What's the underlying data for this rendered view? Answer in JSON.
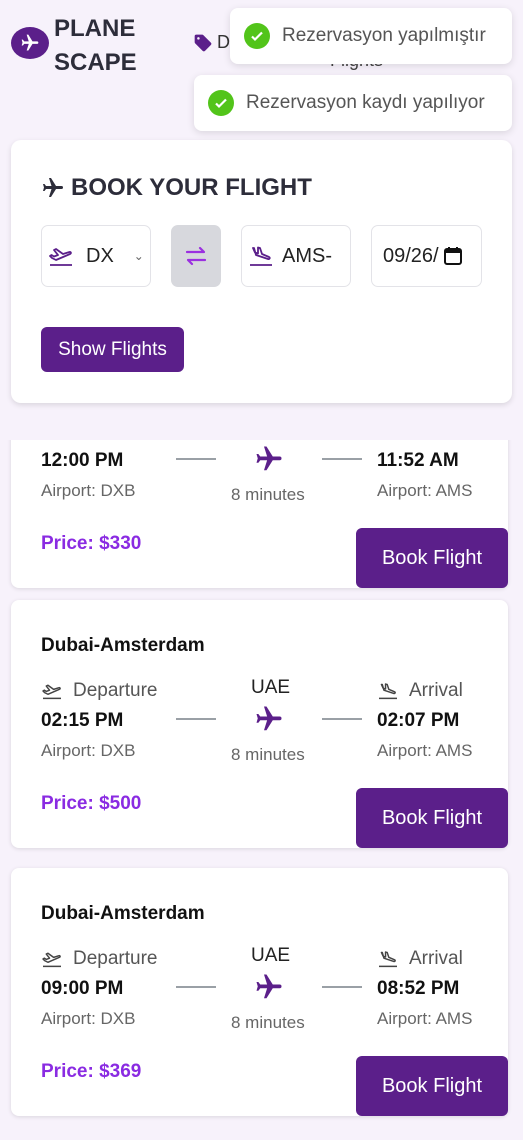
{
  "header": {
    "logo_line1": "PLANE",
    "logo_line2": "SCAPE",
    "deals_label": "D",
    "flights_label": "Flights"
  },
  "toasts": [
    {
      "text": "Rezervasyon yapılmıştır",
      "icon": "check-circle-icon"
    },
    {
      "text": "Rezervasyon kaydı yapılıyor",
      "icon": "check-circle-icon"
    }
  ],
  "booking": {
    "title": "BOOK YOUR FLIGHT",
    "from_value": "DX",
    "to_value": "AMS-",
    "date_value": "09/26/",
    "show_button": "Show Flights"
  },
  "flights": [
    {
      "route": "",
      "departure_label": "",
      "arrival_label": "",
      "airline": "",
      "dep_time": "12:00 PM",
      "arr_time": "11:52 AM",
      "dep_airport": "Airport: DXB",
      "arr_airport": "Airport: AMS",
      "duration": "8 minutes",
      "price": "Price: $330",
      "book_label": "Book Flight"
    },
    {
      "route": "Dubai-Amsterdam",
      "departure_label": "Departure",
      "arrival_label": "Arrival",
      "airline": "UAE",
      "dep_time": "02:15 PM",
      "arr_time": "02:07 PM",
      "dep_airport": "Airport: DXB",
      "arr_airport": "Airport: AMS",
      "duration": "8 minutes",
      "price": "Price: $500",
      "book_label": "Book Flight"
    },
    {
      "route": "Dubai-Amsterdam",
      "departure_label": "Departure",
      "arrival_label": "Arrival",
      "airline": "UAE",
      "dep_time": "09:00 PM",
      "arr_time": "08:52 PM",
      "dep_airport": "Airport: DXB",
      "arr_airport": "Airport: AMS",
      "duration": "8 minutes",
      "price": "Price: $369",
      "book_label": "Book Flight"
    }
  ],
  "colors": {
    "brand": "#5b1f8a",
    "price": "#8a2be2",
    "success": "#52c41a"
  }
}
